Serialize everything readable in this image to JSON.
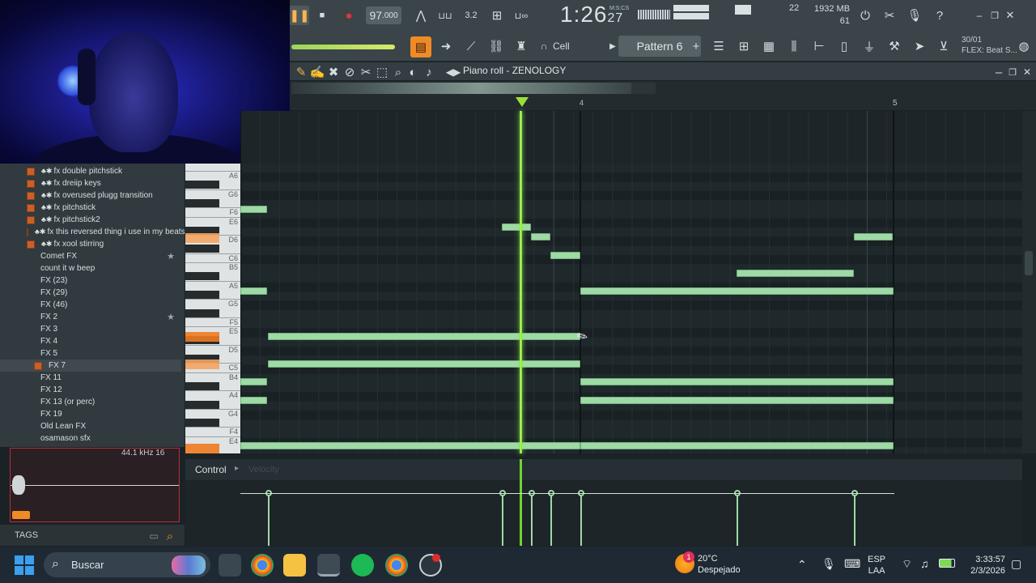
{
  "webcam": {
    "name": "webcam-overlay"
  },
  "toolbar": {
    "tempo_int": "97",
    "tempo_dec": ".000",
    "time": "1:26",
    "time_small": "27",
    "time_mode": "M:S:CS",
    "cpu": "22",
    "ram": "1932 MB",
    "voices": "61",
    "snap": "Cell",
    "pattern": "Pattern 6",
    "hint_line1": "30/01",
    "hint_line2": "FLEX: Beat S..."
  },
  "piano_roll": {
    "title": "Piano roll - ZENOLOGY",
    "bar_markers": [
      "4",
      "5"
    ]
  },
  "browser": {
    "items": [
      {
        "label": "fx double pitchstick",
        "kind": "clover"
      },
      {
        "label": "fx dreiip keys",
        "kind": "clover"
      },
      {
        "label": "fx overused plugg transition",
        "kind": "clover"
      },
      {
        "label": "fx pitchstick",
        "kind": "clover"
      },
      {
        "label": "fx pitchstick2",
        "kind": "clover"
      },
      {
        "label": "fx this reversed thing i use in my beats",
        "kind": "clover"
      },
      {
        "label": "fx xool stirring",
        "kind": "clover"
      },
      {
        "label": "Comet FX",
        "kind": "plain",
        "star": true
      },
      {
        "label": "count it w beep",
        "kind": "plain"
      },
      {
        "label": "FX (23)",
        "kind": "plain"
      },
      {
        "label": "FX (29)",
        "kind": "plain"
      },
      {
        "label": "FX (46)",
        "kind": "plain"
      },
      {
        "label": "FX 2",
        "kind": "plain",
        "star": true
      },
      {
        "label": "FX 3",
        "kind": "plain"
      },
      {
        "label": "FX 4",
        "kind": "plain"
      },
      {
        "label": "FX 5",
        "kind": "plain"
      },
      {
        "label": "FX 7",
        "kind": "selected"
      },
      {
        "label": "FX 11",
        "kind": "plain"
      },
      {
        "label": "FX 12",
        "kind": "plain"
      },
      {
        "label": "FX 13 (or perc)",
        "kind": "plain"
      },
      {
        "label": "FX 19",
        "kind": "plain"
      },
      {
        "label": "Old Lean FX",
        "kind": "plain"
      },
      {
        "label": "osamason sfx",
        "kind": "plain"
      }
    ],
    "sample_info": "44.1 kHz 16",
    "tags_label": "TAGS"
  },
  "keys": [
    "A6",
    "G6",
    "F6",
    "E6",
    "D6",
    "C6",
    "B5",
    "A5",
    "G5",
    "F5",
    "E5",
    "D5",
    "C5",
    "B4",
    "A4",
    "G4",
    "F4",
    "E4"
  ],
  "control": {
    "label": "Control",
    "sub": "Velocity"
  },
  "taskbar": {
    "search_placeholder": "Buscar",
    "weather_temp": "20°C",
    "weather_desc": "Despejado",
    "lang1": "ESP",
    "lang2": "LAA",
    "clock_time": "3:33:57",
    "clock_date": "2/3/2026",
    "weather_badge": "1"
  }
}
